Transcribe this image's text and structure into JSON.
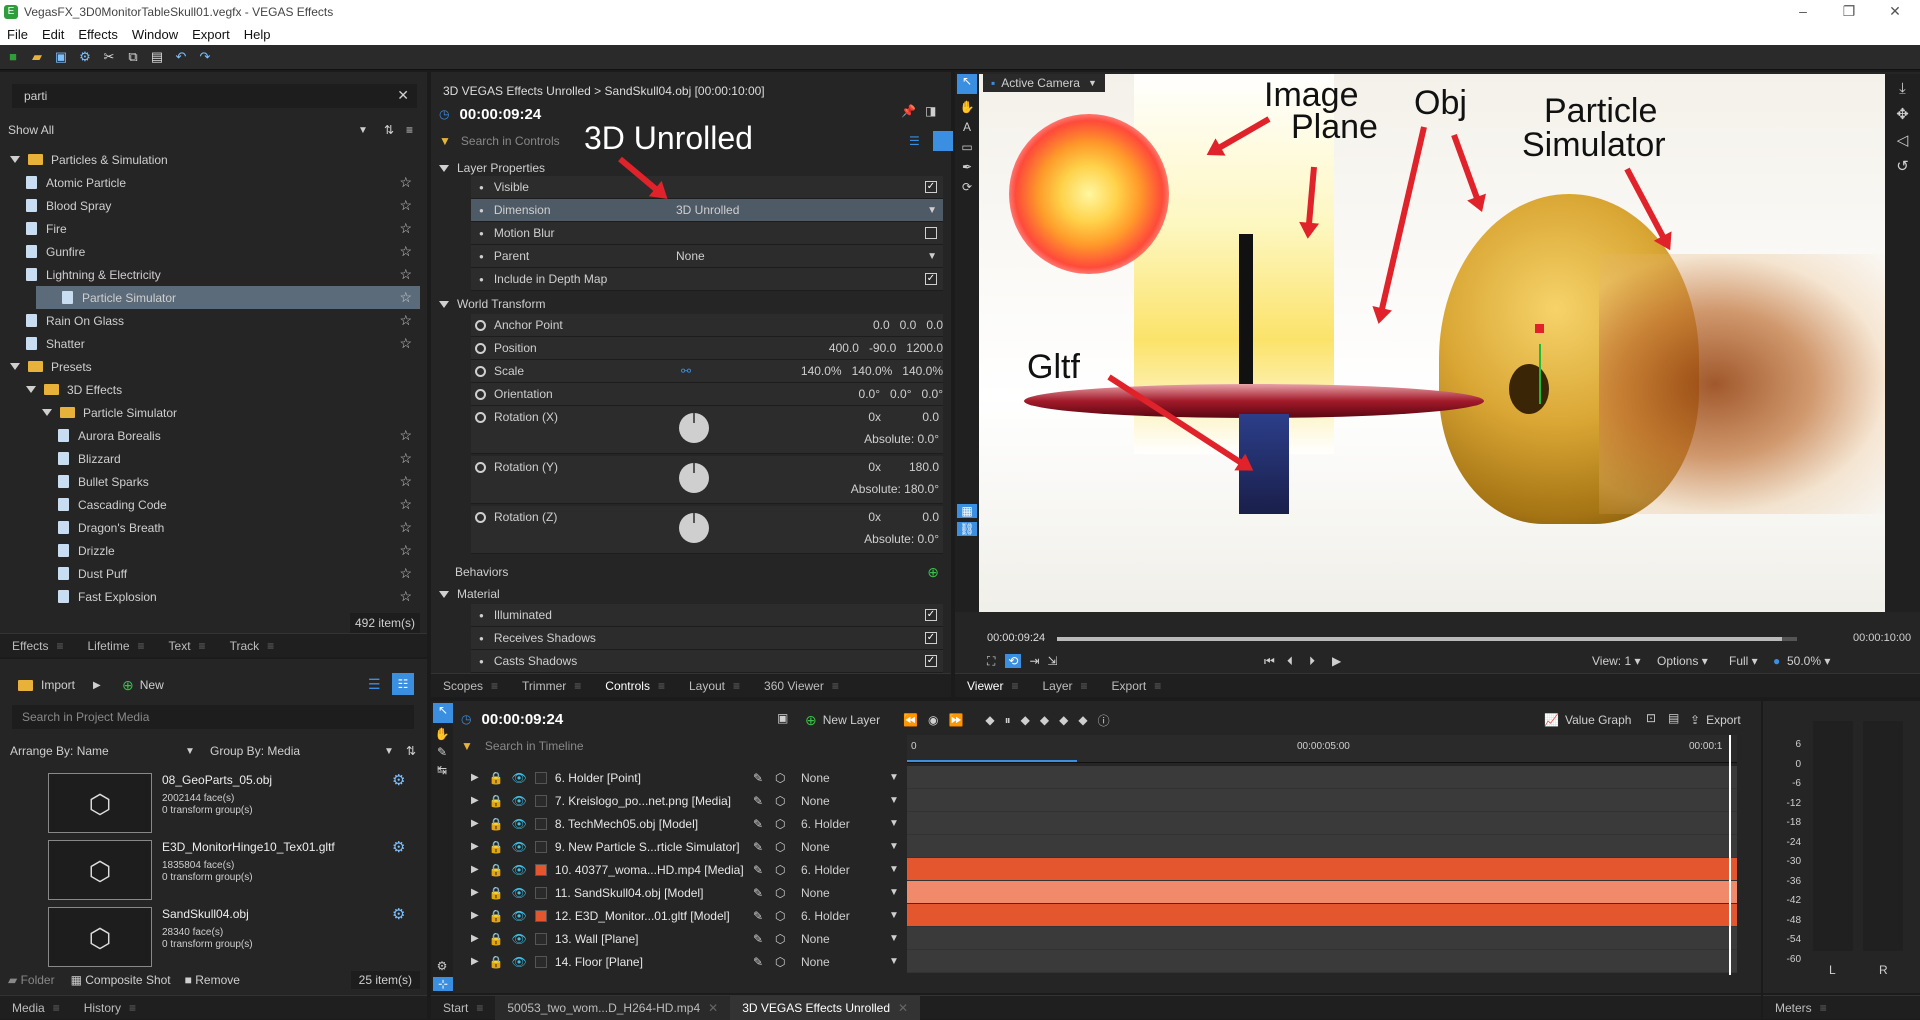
{
  "window": {
    "title": "VegasFX_3D0MonitorTableSkull01.vegfx - VEGAS Effects",
    "app_icon": "E"
  },
  "menu": [
    "File",
    "Edit",
    "Effects",
    "Window",
    "Export",
    "Help"
  ],
  "effects_panel": {
    "search_value": "parti",
    "show_all": "Show All",
    "count": "492 item(s)",
    "tree": [
      {
        "type": "folder",
        "label": "Particles & Simulation",
        "depth": 0
      },
      {
        "type": "item",
        "label": "Atomic Particle",
        "depth": 1
      },
      {
        "type": "item",
        "label": "Blood Spray",
        "depth": 1
      },
      {
        "type": "item",
        "label": "Fire",
        "depth": 1
      },
      {
        "type": "item",
        "label": "Gunfire",
        "depth": 1
      },
      {
        "type": "item",
        "label": "Lightning & Electricity",
        "depth": 1
      },
      {
        "type": "item",
        "label": "Particle Simulator",
        "depth": 1,
        "selected": true
      },
      {
        "type": "item",
        "label": "Rain On Glass",
        "depth": 1
      },
      {
        "type": "item",
        "label": "Shatter",
        "depth": 1
      },
      {
        "type": "folder",
        "label": "Presets",
        "depth": 0
      },
      {
        "type": "folder",
        "label": "3D Effects",
        "depth": 1
      },
      {
        "type": "folder",
        "label": "Particle Simulator",
        "depth": 2
      },
      {
        "type": "item",
        "label": "Aurora Borealis",
        "depth": 3
      },
      {
        "type": "item",
        "label": "Blizzard",
        "depth": 3
      },
      {
        "type": "item",
        "label": "Bullet Sparks",
        "depth": 3
      },
      {
        "type": "item",
        "label": "Cascading Code",
        "depth": 3
      },
      {
        "type": "item",
        "label": "Dragon's Breath",
        "depth": 3
      },
      {
        "type": "item",
        "label": "Drizzle",
        "depth": 3
      },
      {
        "type": "item",
        "label": "Dust Puff",
        "depth": 3
      },
      {
        "type": "item",
        "label": "Fast Explosion",
        "depth": 3
      }
    ],
    "tabs": [
      "Effects",
      "Lifetime",
      "Text",
      "Track"
    ]
  },
  "media_panel": {
    "import": "Import",
    "new": "New",
    "search_placeholder": "Search in Project Media",
    "arrange": "Arrange By: Name",
    "group": "Group By: Media",
    "items": [
      {
        "name": "08_GeoParts_05.obj",
        "faces": "2002144 face(s)",
        "groups": "0 transform group(s)"
      },
      {
        "name": "E3D_MonitorHinge10_Tex01.gltf",
        "faces": "1835804 face(s)",
        "groups": "0 transform group(s)"
      },
      {
        "name": "SandSkull04.obj",
        "faces": "28340 face(s)",
        "groups": "0 transform group(s)"
      }
    ],
    "folder": "Folder",
    "composite": "Composite Shot",
    "remove": "Remove",
    "count": "25 item(s)",
    "tabs": [
      "Media",
      "History"
    ]
  },
  "controls_panel": {
    "breadcrumb": "3D VEGAS Effects Unrolled > SandSkull04.obj [00:00:10:00]",
    "time": "00:00:09:24",
    "search_placeholder": "Search in Controls",
    "layer_properties": "Layer Properties",
    "props": [
      {
        "label": "Visible",
        "checked": true
      },
      {
        "label": "Dimension",
        "value": "3D Unrolled",
        "dropdown": true,
        "selected": true
      },
      {
        "label": "Motion Blur",
        "checked": false
      },
      {
        "label": "Parent",
        "value": "None",
        "dropdown": true
      },
      {
        "label": "Include in Depth Map",
        "checked": true
      }
    ],
    "world_transform": "World Transform",
    "transform": [
      {
        "label": "Anchor Point",
        "values": [
          "0.0",
          "0.0",
          "0.0"
        ]
      },
      {
        "label": "Position",
        "values": [
          "400.0",
          "-90.0",
          "1200.0"
        ]
      },
      {
        "label": "Scale",
        "values": [
          "140.0%",
          "140.0%",
          "140.0%"
        ]
      },
      {
        "label": "Orientation",
        "values": [
          "0.0°",
          "0.0°",
          "0.0°"
        ]
      }
    ],
    "rotations": [
      {
        "label": "Rotation (X)",
        "turns": "0x",
        "deg": "0.0",
        "abs": "Absolute: 0.0°"
      },
      {
        "label": "Rotation (Y)",
        "turns": "0x",
        "deg": "180.0",
        "abs": "Absolute: 180.0°"
      },
      {
        "label": "Rotation (Z)",
        "turns": "0x",
        "deg": "0.0",
        "abs": "Absolute: 0.0°"
      }
    ],
    "behaviors": "Behaviors",
    "material": "Material",
    "material_props": [
      {
        "label": "Illuminated",
        "checked": true
      },
      {
        "label": "Receives Shadows",
        "checked": true
      },
      {
        "label": "Casts Shadows",
        "checked": true
      }
    ],
    "tabs": [
      "Scopes",
      "Trimmer",
      "Controls",
      "Layout",
      "360 Viewer"
    ]
  },
  "viewer": {
    "camera": "Active Camera",
    "time_left": "00:00:09:24",
    "time_right": "00:00:10:00",
    "view": "View: 1",
    "options": "Options",
    "full": "Full",
    "zoom": "50.0%",
    "tabs": [
      "Viewer",
      "Layer",
      "Export"
    ]
  },
  "annotations": {
    "unrolled": "3D Unrolled",
    "image_plane_1": "Image",
    "image_plane_2": "Plane",
    "obj": "Obj",
    "particle_1": "Particle",
    "particle_2": "Simulator",
    "gltf": "Gltf"
  },
  "timeline": {
    "time": "00:00:09:24",
    "new_layer": "New Layer",
    "value_graph": "Value Graph",
    "export": "Export",
    "search_placeholder": "Search in Timeline",
    "ruler": [
      "0",
      "00:00:05:00",
      "00:00:1"
    ],
    "layers": [
      {
        "name": "6. Holder [Point]",
        "parent": "None",
        "color": "#2a2a2a",
        "bar": false
      },
      {
        "name": "7. Kreislogo_po...net.png [Media]",
        "parent": "None",
        "color": "#2a2a2a",
        "bar": false
      },
      {
        "name": "8. TechMech05.obj [Model]",
        "parent": "6. Holder",
        "color": "#2a2a2a",
        "bar": false
      },
      {
        "name": "9. New Particle S...rticle Simulator]",
        "parent": "None",
        "color": "#2a2a2a",
        "bar": false
      },
      {
        "name": "10. 40377_woma...HD.mp4 [Media]",
        "parent": "6. Holder",
        "color": "#e4572e",
        "bar": true
      },
      {
        "name": "11. SandSkull04.obj [Model]",
        "parent": "None",
        "color": "#2a2a2a",
        "bar": true,
        "light": true
      },
      {
        "name": "12. E3D_Monitor...01.gltf [Model]",
        "parent": "6. Holder",
        "color": "#e4572e",
        "bar": true
      },
      {
        "name": "13. Wall [Plane]",
        "parent": "None",
        "color": "#2a2a2a",
        "bar": false
      },
      {
        "name": "14. Floor [Plane]",
        "parent": "None",
        "color": "#2a2a2a",
        "bar": false
      }
    ]
  },
  "meters": {
    "scale": [
      "6",
      "0",
      "-6",
      "-12",
      "-18",
      "-24",
      "-30",
      "-36",
      "-42",
      "-48",
      "-54",
      "-60"
    ],
    "l": "L",
    "r": "R",
    "tab": "Meters"
  },
  "bottom_tabs": {
    "start": "Start",
    "clip": "50053_two_wom...D_H264-HD.mp4",
    "project": "3D VEGAS Effects Unrolled"
  }
}
